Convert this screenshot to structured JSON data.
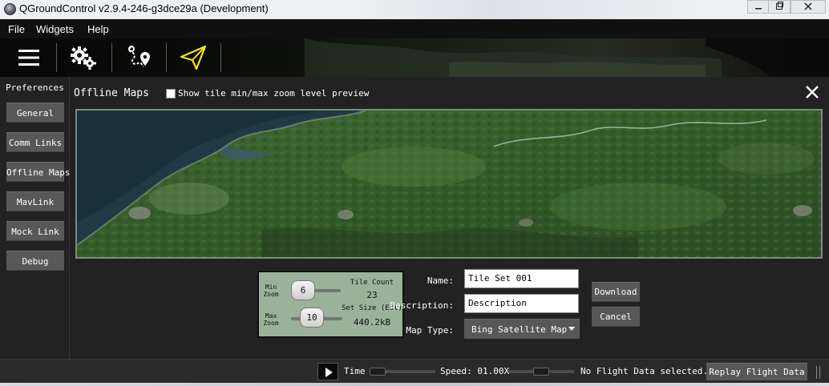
{
  "window": {
    "title": "QGroundControl v2.9.4-246-g3dce29a (Development)",
    "minimize_icon": "minimize-icon",
    "maximize_icon": "maximize-icon",
    "close_icon": "close-icon"
  },
  "menubar": {
    "items": [
      "File",
      "Widgets",
      "Help"
    ]
  },
  "toolbar": {
    "icons": [
      "hamburger-menu-icon",
      "gears-icon",
      "route-plan-icon",
      "paper-plane-icon"
    ]
  },
  "sidebar": {
    "heading": "Preferences",
    "items": [
      "General",
      "Comm Links",
      "Offline Maps",
      "MavLink",
      "Mock Link",
      "Debug"
    ],
    "selected": "Offline Maps"
  },
  "offline_maps": {
    "title": "Offline Maps",
    "preview_checkbox_label": "Show tile min/max zoom level preview",
    "preview_checked": false,
    "zoom": {
      "min_label": "Min Zoom",
      "min_value": "6",
      "max_label": "Max Zoom",
      "max_value": "10",
      "tile_count_label": "Tile Count",
      "tile_count": "23",
      "set_size_label": "Set Size (Est)",
      "set_size": "440.2kB"
    },
    "form": {
      "name_label": "Name:",
      "name_value": "Tile Set 001",
      "description_label": "Description:",
      "description_value": "Description",
      "map_type_label": "Map Type:",
      "map_type_value": "Bing Satellite Map"
    },
    "download_label": "Download",
    "cancel_label": "Cancel"
  },
  "statusbar": {
    "time_label": "Time",
    "speed_label": "Speed: 01.00X",
    "status_text": "No Flight Data selected..",
    "replay_label": "Replay Flight Data"
  },
  "colors": {
    "accent_yellow": "#f3e51a",
    "button_gray": "#585858",
    "zoom_panel_green": "#9ab29a"
  }
}
